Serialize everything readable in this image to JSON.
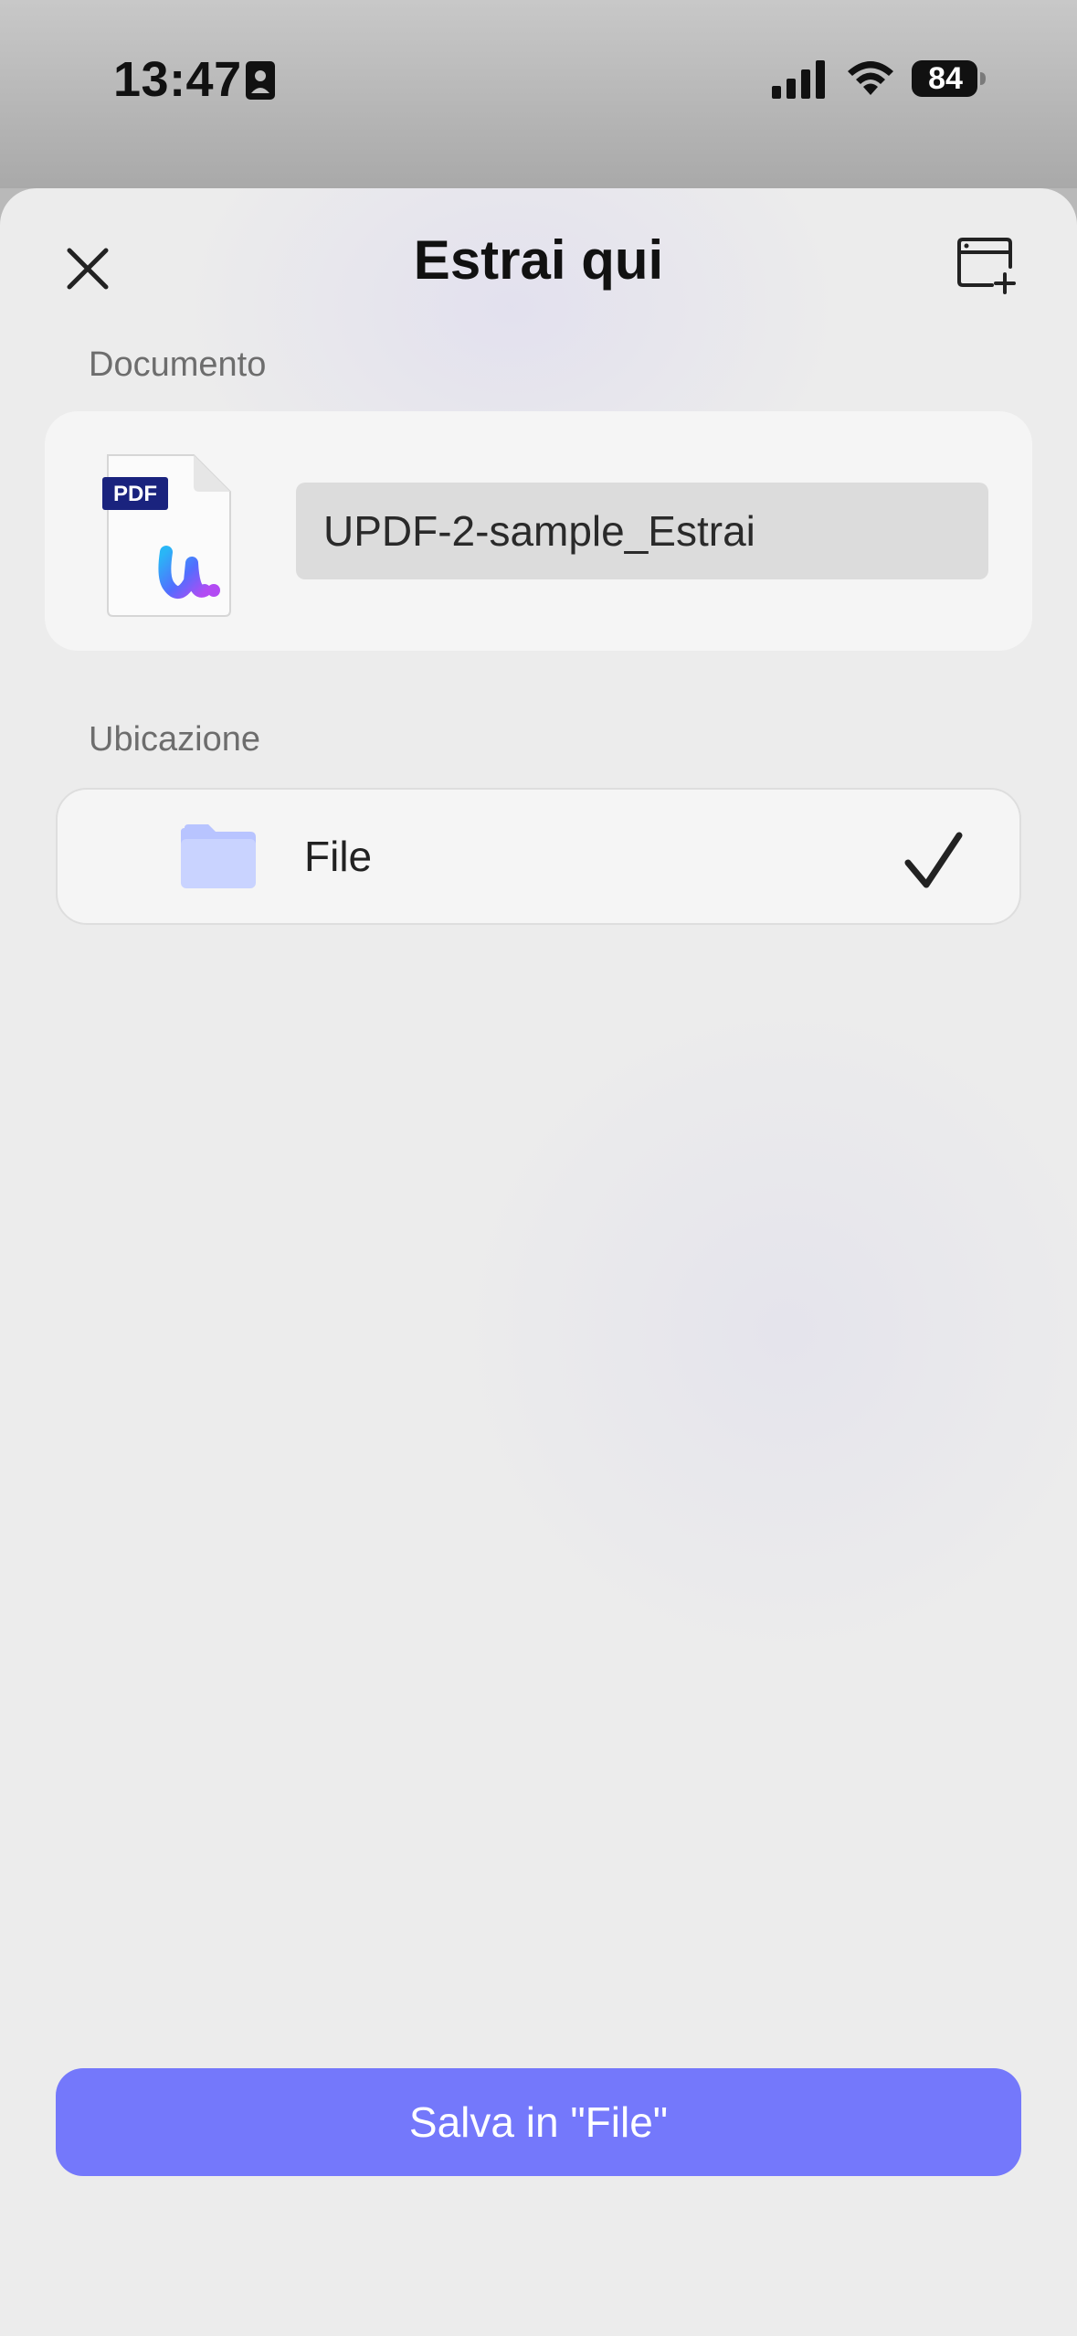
{
  "status_bar": {
    "time": "13:47",
    "battery": "84",
    "icons": [
      "id-badge-icon",
      "signal-icon",
      "wifi-icon",
      "battery-icon"
    ]
  },
  "sheet": {
    "title": "Estrai qui",
    "close_icon": "close-icon",
    "new_window_icon": "new-window-icon"
  },
  "document": {
    "section_label": "Documento",
    "thumb_badge": "PDF",
    "filename": "UPDF-2-sample_Estrai"
  },
  "location": {
    "section_label": "Ubicazione",
    "name": "File",
    "icon": "folder-icon",
    "selected_icon": "checkmark-icon"
  },
  "actions": {
    "save_label": "Salva in \"File\""
  },
  "colors": {
    "accent": "#7478fb",
    "pdf_badge": "#1a237e",
    "folder": "#c9d3ff"
  }
}
